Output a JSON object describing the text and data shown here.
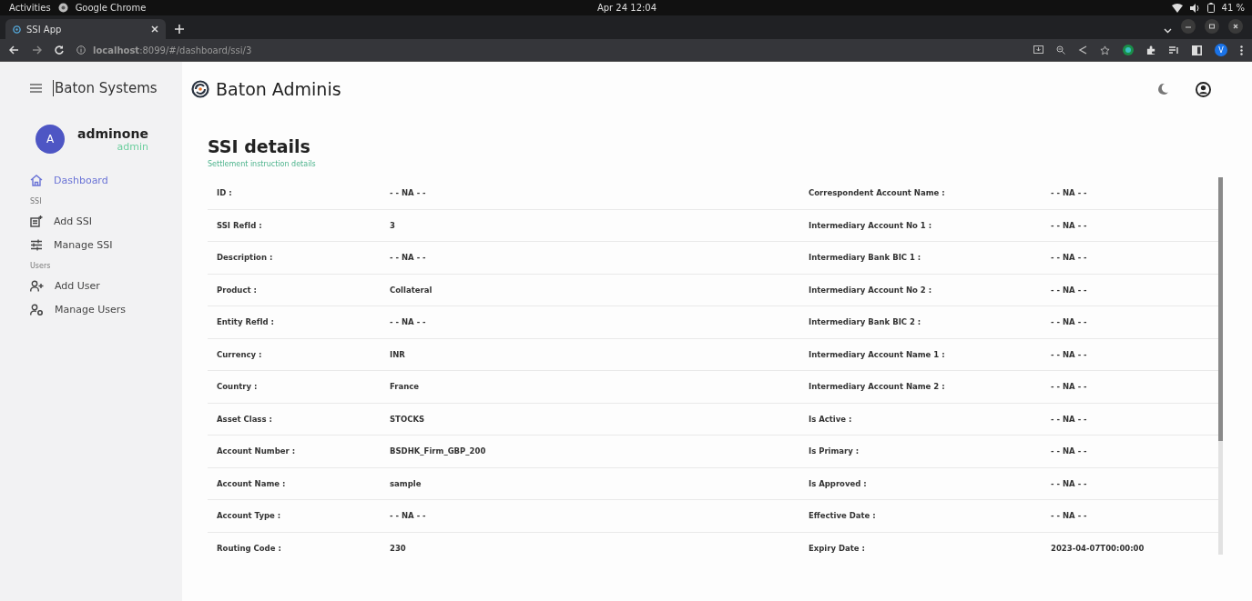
{
  "system_bar": {
    "activities": "Activities",
    "app": "Google Chrome",
    "clock": "Apr 24 12:04",
    "battery": "41 %"
  },
  "browser": {
    "tab": {
      "title": "SSI App",
      "selected": true
    },
    "url": "**localhost**:8099/#/dashboard/ssi/3",
    "profile": "V"
  },
  "sidebar": {
    "brand": "Baton Systems",
    "user": {
      "initial": "A",
      "name": "adminone",
      "role": "admin"
    },
    "items": [
      {
        "kind": "link",
        "label": "Dashboard",
        "selected": true
      },
      {
        "kind": "section",
        "label": "SSI"
      },
      {
        "kind": "link",
        "label": "Add SSI",
        "selected": false
      },
      {
        "kind": "link",
        "label": "Manage SSI",
        "selected": false
      },
      {
        "kind": "section",
        "label": "Users"
      },
      {
        "kind": "link",
        "label": "Add User",
        "selected": false
      },
      {
        "kind": "link",
        "label": "Manage Users",
        "selected": false
      }
    ]
  },
  "header": {
    "title": "Baton Adminis"
  },
  "page": {
    "title": "SSI details",
    "subtitle": "Settlement instruction details"
  },
  "rows": [
    {
      "left": {
        "label": "ID :",
        "value": "- - NA - -"
      },
      "right": {
        "label": "Correspondent Account Name :",
        "value": "- - NA - -"
      }
    },
    {
      "left": {
        "label": "SSI RefId :",
        "value": "3"
      },
      "right": {
        "label": "Intermediary Account No 1 :",
        "value": "- - NA - -"
      }
    },
    {
      "left": {
        "label": "Description :",
        "value": "- - NA - -"
      },
      "right": {
        "label": "Intermediary Bank BIC 1 :",
        "value": "- - NA - -"
      }
    },
    {
      "left": {
        "label": "Product :",
        "value": "Collateral"
      },
      "right": {
        "label": "Intermediary Account No 2 :",
        "value": "- - NA - -"
      }
    },
    {
      "left": {
        "label": "Entity RefId :",
        "value": "- - NA - -"
      },
      "right": {
        "label": "Intermediary Bank BIC 2 :",
        "value": "- - NA - -"
      }
    },
    {
      "left": {
        "label": "Currency :",
        "value": "INR"
      },
      "right": {
        "label": "Intermediary Account Name 1 :",
        "value": "- - NA - -"
      }
    },
    {
      "left": {
        "label": "Country :",
        "value": "France"
      },
      "right": {
        "label": "Intermediary Account Name 2 :",
        "value": "- - NA - -"
      }
    },
    {
      "left": {
        "label": "Asset Class :",
        "value": "STOCKS"
      },
      "right": {
        "label": "Is Active :",
        "value": "- - NA - -"
      }
    },
    {
      "left": {
        "label": "Account Number :",
        "value": "BSDHK_Firm_GBP_200"
      },
      "right": {
        "label": "Is Primary :",
        "value": "- - NA - -"
      }
    },
    {
      "left": {
        "label": "Account Name :",
        "value": "sample"
      },
      "right": {
        "label": "Is Approved :",
        "value": "- - NA - -"
      }
    },
    {
      "left": {
        "label": "Account Type :",
        "value": "- - NA - -"
      },
      "right": {
        "label": "Effective Date :",
        "value": "- - NA - -"
      }
    },
    {
      "left": {
        "label": "Routing Code :",
        "value": "230"
      },
      "right": {
        "label": "Expiry Date :",
        "value": "2023-04-07T00:00:00"
      }
    }
  ]
}
